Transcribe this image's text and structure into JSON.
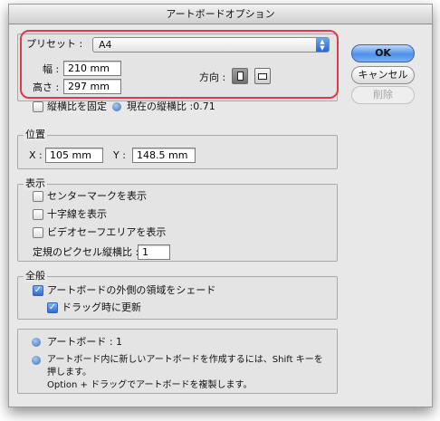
{
  "window": {
    "title": "アートボードオプション"
  },
  "preset": {
    "label": "プリセット :",
    "value": "A4",
    "width_label": "幅 :",
    "width_value": "210 mm",
    "height_label": "高さ :",
    "height_value": "297 mm",
    "orientation_label": "方向 :"
  },
  "constrain": {
    "label": "縦横比を固定",
    "current_ratio_label": "現在の縦横比 :0.71"
  },
  "position": {
    "title": "位置",
    "x_label": "X :",
    "x_value": "105 mm",
    "y_label": "Y :",
    "y_value": "148.5 mm"
  },
  "display": {
    "title": "表示",
    "center_mark": "センターマークを表示",
    "cross_hairs": "十字線を表示",
    "video_safe": "ビデオセーフエリアを表示",
    "pixel_ratio_label": "定規のピクセル縦横比 :",
    "pixel_ratio_value": "1"
  },
  "global": {
    "title": "全般",
    "fade_outside": "アートボードの外側の領域をシェード",
    "update_drag": "ドラッグ時に更新"
  },
  "info": {
    "artboards": "アートボード : 1",
    "tip_line1": "アートボード内に新しいアートボードを作成するには、Shift キーを",
    "tip_line2": "押します。",
    "tip_line3": "Option + ドラッグでアートボードを複製します。"
  },
  "buttons": {
    "ok": "OK",
    "cancel": "キャンセル",
    "delete": "削除"
  },
  "colors": {
    "highlight": "#e03a4a",
    "accent": "#2d6bd6"
  }
}
